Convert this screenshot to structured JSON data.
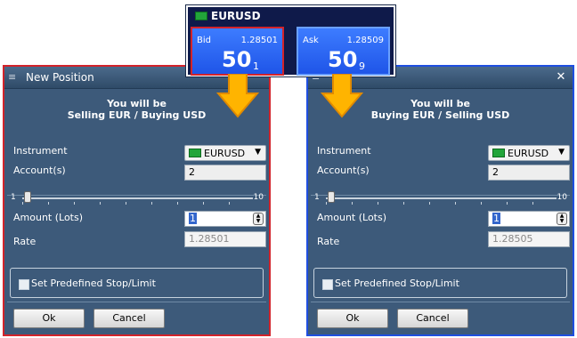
{
  "quote": {
    "symbol": "EURUSD",
    "bid": {
      "label": "Bid",
      "full": "1.28501",
      "big": "50",
      "small": "1"
    },
    "ask": {
      "label": "Ask",
      "full": "1.28509",
      "big": "50",
      "small": "9"
    }
  },
  "dialogs": [
    {
      "title": "New Position",
      "message_line1": "You will be",
      "message_line2": "Selling EUR / Buying USD",
      "instrument_label": "Instrument",
      "instrument_value": "EURUSD",
      "accounts_label": "Account(s)",
      "accounts_value": "2",
      "slider_min": "1",
      "slider_max": "10",
      "amount_label": "Amount (Lots)",
      "amount_value": "1",
      "rate_label": "Rate",
      "rate_value": "1.28501",
      "stop_label": "Set Predefined Stop/Limit",
      "ok_label": "Ok",
      "cancel_label": "Cancel"
    },
    {
      "title": "",
      "message_line1": "You will be",
      "message_line2": "Buying EUR / Selling USD",
      "instrument_label": "Instrument",
      "instrument_value": "EURUSD",
      "accounts_label": "Account(s)",
      "accounts_value": "2",
      "slider_min": "1",
      "slider_max": "10",
      "amount_label": "Amount (Lots)",
      "amount_value": "1",
      "rate_label": "Rate",
      "rate_value": "1.28505",
      "stop_label": "Set Predefined Stop/Limit",
      "ok_label": "Ok",
      "cancel_label": "Cancel"
    }
  ],
  "colors": {
    "bid_highlight": "#d3232a",
    "ask_highlight": "#1f4fe0",
    "arrow": "#ffb400",
    "dialog_bg": "#3d5a7a"
  }
}
